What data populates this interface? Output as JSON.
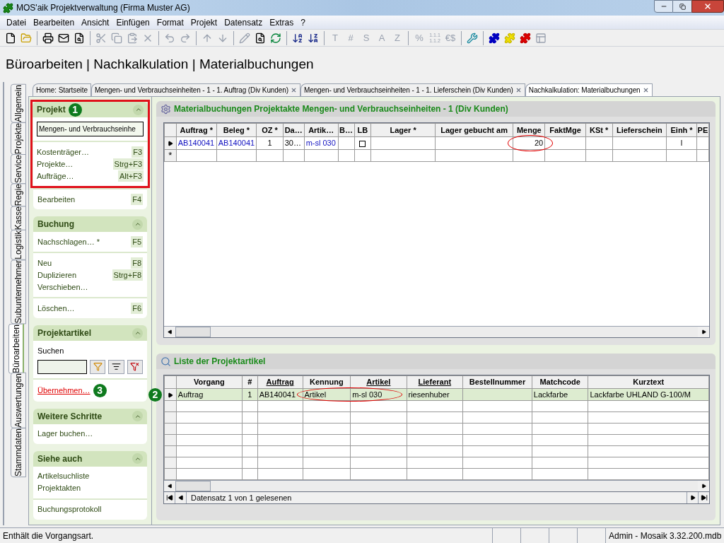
{
  "window": {
    "title": "MOS'aik Projektverwaltung (Firma Muster AG)"
  },
  "menu": [
    "Datei",
    "Bearbeiten",
    "Ansicht",
    "Einfügen",
    "Format",
    "Projekt",
    "Datensatz",
    "Extras",
    "?"
  ],
  "toolbar": {
    "glyph_groups": [
      [
        {
          "text": "T",
          "disabled": true
        },
        {
          "text": "#",
          "disabled": true
        },
        {
          "text": "S",
          "disabled": true
        },
        {
          "text": "A",
          "disabled": true
        },
        {
          "text": "Z",
          "disabled": true
        }
      ],
      [
        {
          "text": "%",
          "disabled": true
        },
        {
          "text": "1.1.1 1.1.2",
          "disabled": true
        },
        {
          "text": "€$",
          "disabled": true
        }
      ]
    ]
  },
  "page_title": "Büroarbeiten | Nachkalkulation | Materialbuchungen",
  "side_tabs": [
    {
      "label": "Allgemein",
      "selected": false
    },
    {
      "label": "Projekte",
      "selected": false
    },
    {
      "label": "Service",
      "selected": false
    },
    {
      "label": "Regie",
      "selected": false
    },
    {
      "label": "Kasse",
      "selected": false
    },
    {
      "label": "Logistik",
      "selected": false
    },
    {
      "label": "Subunternehmer",
      "selected": false
    },
    {
      "label": "Büroarbeiten",
      "selected": true
    },
    {
      "label": "Auswertungen",
      "selected": false
    },
    {
      "label": "Stammdaten",
      "selected": false
    }
  ],
  "doc_tabs": [
    {
      "label": "Home: Startseite",
      "closable": false,
      "selected": false
    },
    {
      "label": "Mengen- und Verbrauchseinheiten - 1 - 1. Auftrag (Div Kunden)",
      "closable": true,
      "selected": false
    },
    {
      "label": "Mengen- und Verbrauchseinheiten - 1 - 1. Lieferschein (Div Kunden)",
      "closable": true,
      "selected": false
    },
    {
      "label": "Nachkalkulation: Materialbuchungen",
      "closable": true,
      "selected": true
    }
  ],
  "sidebar": {
    "sections": [
      {
        "title": "Projekt",
        "badge": "1",
        "groups": [
          {
            "highlighted": true,
            "items": [
              {
                "kind": "field",
                "value": "Mengen- und Verbrauchseinhe"
              }
            ]
          },
          {
            "highlighted": true,
            "items": [
              {
                "kind": "command",
                "label": "Kostenträger…",
                "shortcut": "F3"
              },
              {
                "kind": "command",
                "label": "Projekte…",
                "shortcut": "Strg+F3"
              },
              {
                "kind": "command",
                "label": "Aufträge…",
                "shortcut": "Alt+F3"
              }
            ]
          },
          {
            "items": [
              {
                "kind": "command",
                "label": "Bearbeiten",
                "shortcut": "F4"
              }
            ]
          }
        ]
      },
      {
        "title": "Buchung",
        "groups": [
          {
            "items": [
              {
                "kind": "command",
                "label": "Nachschlagen… *",
                "shortcut": "F5"
              }
            ]
          },
          {
            "items": [
              {
                "kind": "command",
                "label": "Neu",
                "shortcut": "F8"
              },
              {
                "kind": "command",
                "label": "Duplizieren",
                "shortcut": "Strg+F8"
              },
              {
                "kind": "command",
                "label": "Verschieben…"
              }
            ]
          },
          {
            "items": [
              {
                "kind": "command",
                "label": "Löschen…",
                "shortcut": "F6"
              }
            ]
          }
        ]
      },
      {
        "title": "Projektartikel",
        "groups": [
          {
            "items": [
              {
                "kind": "search",
                "label": "Suchen"
              }
            ]
          },
          {
            "items": [
              {
                "kind": "alert-link",
                "label": "Übernehmen…",
                "badge": "3"
              }
            ]
          }
        ]
      },
      {
        "title": "Weitere Schritte",
        "groups": [
          {
            "items": [
              {
                "kind": "command",
                "label": "Lager buchen…"
              }
            ]
          }
        ]
      },
      {
        "title": "Siehe auch",
        "groups": [
          {
            "items": [
              {
                "kind": "command",
                "label": "Artikelsuchliste"
              },
              {
                "kind": "command",
                "label": "Projektakten"
              }
            ]
          },
          {
            "items": [
              {
                "kind": "command",
                "label": "Buchungsprotokoll"
              }
            ]
          }
        ]
      }
    ]
  },
  "booking_panel": {
    "title": "Materialbuchungen Projektakte Mengen- und Verbrauchseinheiten - 1 (Div Kunden)",
    "columns": [
      "Auftrag *",
      "Beleg *",
      "OZ *",
      "Da…",
      "Artik…",
      "B…",
      "LB",
      "Lager *",
      "Lager gebucht am",
      "Menge",
      "FaktMge",
      "KSt *",
      "Lieferschein",
      "Einh *",
      "PE"
    ],
    "rows": [
      {
        "current": true,
        "cells": [
          {
            "text": "AB140041",
            "link": true
          },
          {
            "text": "AB140041",
            "link": true
          },
          {
            "text": "1",
            "link": false
          },
          {
            "text": "30…",
            "link": false
          },
          {
            "text": "m-sl 030",
            "link": true
          },
          null,
          {
            "kind": "checkbox",
            "checked": false
          },
          null,
          null,
          {
            "text": "20",
            "link": false,
            "circled": true
          },
          null,
          null,
          null,
          {
            "text": "l",
            "link": false
          },
          null
        ]
      }
    ],
    "new_row_marker": "*"
  },
  "article_panel": {
    "title": "Liste der Projektartikel",
    "columns": [
      {
        "label": "Vorgang",
        "underlined": false
      },
      {
        "label": "#",
        "underlined": false
      },
      {
        "label": "Auftrag",
        "underlined": true
      },
      {
        "label": "Kennung",
        "underlined": false
      },
      {
        "label": "Artikel",
        "underlined": true
      },
      {
        "label": "Lieferant",
        "underlined": true
      },
      {
        "label": "Bestellnummer",
        "underlined": false
      },
      {
        "label": "Matchcode",
        "underlined": false
      },
      {
        "label": "Kurztext",
        "underlined": false
      }
    ],
    "rows": [
      {
        "selected": true,
        "badge": "2",
        "cells": [
          {
            "text": "Auftrag"
          },
          {
            "text": "1"
          },
          {
            "text": "AB140041"
          },
          {
            "text": "Artikel"
          },
          {
            "text": "m-sl 030",
            "circled": true
          },
          {
            "text": "riesenhuber"
          },
          null,
          {
            "text": "Lackfarbe"
          },
          {
            "text": "Lackfarbe UHLAND G-100/M"
          }
        ]
      }
    ],
    "record_status": "Datensatz 1 von 1 gelesenen"
  },
  "status_bar": {
    "message": "Enthält die Vorgangsart.",
    "database": "Admin - Mosaik 3.32.200.mdb"
  }
}
